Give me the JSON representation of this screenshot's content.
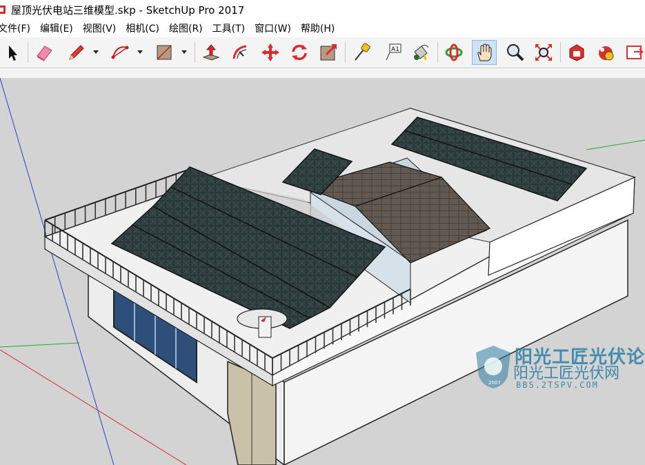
{
  "window": {
    "title": "屋顶光伏电站三维模型.skp - SketchUp Pro 2017"
  },
  "menu": [
    "文件(F)",
    "编辑(E)",
    "视图(V)",
    "相机(C)",
    "绘图(R)",
    "工具(T)",
    "窗口(W)",
    "帮助(H)"
  ],
  "toolbar": {
    "text_tool_label": "A1",
    "active_tool": "pan"
  },
  "watermark": {
    "line1": "阳光工匠光伏论坛",
    "line2": "阳光工匠光伏网",
    "line3": "BBS.2TSPV.COM",
    "badge_year": "2007"
  },
  "colors": {
    "sky": "#ffffff",
    "ground": "#d2d2d2",
    "panel": "#2b3a3c",
    "roof_tile": "#5d5650",
    "wall": "#f2f2f2",
    "axis_red": "#d8262b",
    "axis_green": "#2aa72a",
    "axis_blue": "#2440c8"
  }
}
